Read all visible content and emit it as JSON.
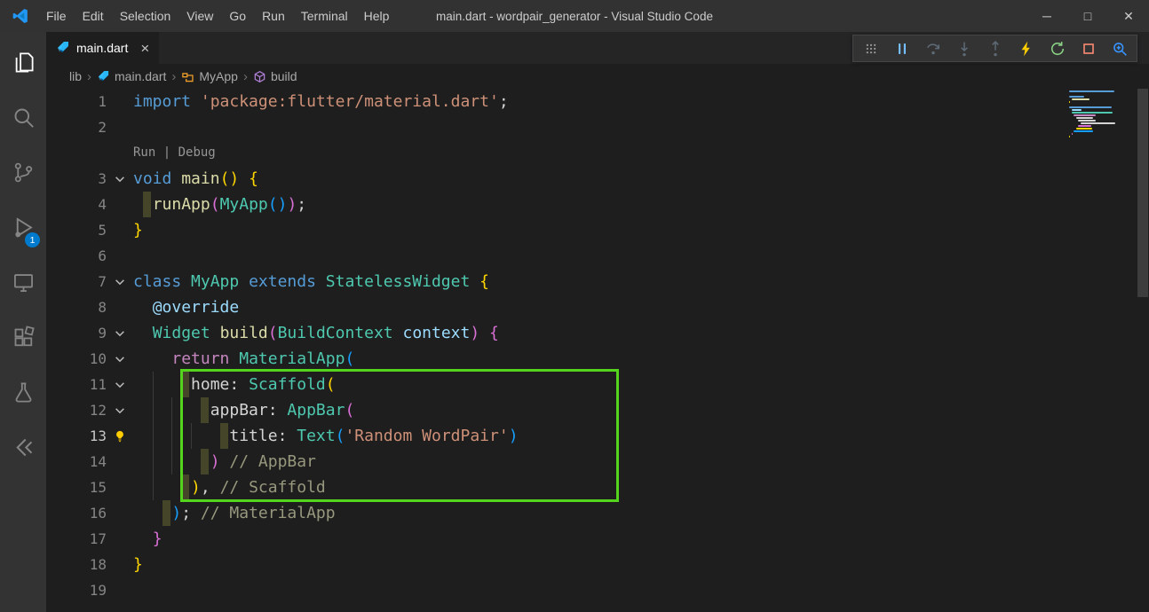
{
  "window": {
    "title": "main.dart - wordpair_generator - Visual Studio Code",
    "menus": [
      "File",
      "Edit",
      "Selection",
      "View",
      "Go",
      "Run",
      "Terminal",
      "Help"
    ],
    "controls": [
      {
        "name": "minimize",
        "glyph": "─"
      },
      {
        "name": "maximize",
        "glyph": "□"
      },
      {
        "name": "close",
        "glyph": "✕"
      }
    ]
  },
  "activity_bar": {
    "items": [
      {
        "name": "explorer",
        "icon": "explorer-icon",
        "active": true
      },
      {
        "name": "search",
        "icon": "search-icon"
      },
      {
        "name": "source-control",
        "icon": "source-control-icon"
      },
      {
        "name": "run-and-debug",
        "icon": "run-debug-icon",
        "badge": "1"
      },
      {
        "name": "remote-explorer",
        "icon": "remote-explorer-icon"
      },
      {
        "name": "extensions",
        "icon": "extensions-icon"
      },
      {
        "name": "testing",
        "icon": "testing-icon"
      },
      {
        "name": "flutter",
        "icon": "flutter-icon"
      }
    ]
  },
  "tabs": [
    {
      "label": "main.dart",
      "icon": "dart-file-icon",
      "close": "×",
      "active": true
    }
  ],
  "debug_toolbar": {
    "buttons": [
      {
        "name": "drag-handle",
        "icon": "drag-handle-icon",
        "color": "#9d9d9d"
      },
      {
        "name": "pause",
        "icon": "pause-icon",
        "color": "#75beff"
      },
      {
        "name": "step-over",
        "icon": "step-over-icon",
        "color": "#63707e",
        "disabled": true
      },
      {
        "name": "step-into",
        "icon": "step-into-icon",
        "color": "#63707e",
        "disabled": true
      },
      {
        "name": "step-out",
        "icon": "step-out-icon",
        "color": "#63707e",
        "disabled": true
      },
      {
        "name": "hot-reload",
        "icon": "hot-reload-icon",
        "color": "#ffcc00"
      },
      {
        "name": "restart",
        "icon": "restart-icon",
        "color": "#89d185"
      },
      {
        "name": "stop",
        "icon": "stop-icon",
        "color": "#f48771"
      },
      {
        "name": "widget-inspector",
        "icon": "widget-inspector-icon",
        "color": "#3794ff"
      }
    ]
  },
  "breadcrumbs": {
    "separator": "›",
    "items": [
      {
        "label": "lib"
      },
      {
        "label": "main.dart",
        "icon": "dart-file-icon"
      },
      {
        "label": "MyApp",
        "icon": "class-symbol-icon"
      },
      {
        "label": "build",
        "icon": "method-symbol-icon"
      }
    ]
  },
  "editor": {
    "codelens": {
      "run": "Run",
      "sep": " | ",
      "debug": "Debug"
    },
    "lines": [
      {
        "num": 1,
        "tokens": [
          [
            "import",
            "kw"
          ],
          [
            " ",
            "pl"
          ],
          [
            "'package:flutter/material.dart'",
            "str"
          ],
          [
            ";",
            "pl"
          ]
        ]
      },
      {
        "num": 2,
        "tokens": []
      },
      {
        "codelens": true
      },
      {
        "num": 3,
        "fold": true,
        "tokens": [
          [
            "void",
            "kw"
          ],
          [
            " ",
            "pl"
          ],
          [
            "main",
            "fn"
          ],
          [
            "(",
            "b1"
          ],
          [
            ")",
            "b1"
          ],
          [
            " ",
            "pl"
          ],
          [
            "{",
            "b1"
          ]
        ]
      },
      {
        "num": 4,
        "marker": 1,
        "tokens": [
          [
            "  ",
            "pl"
          ],
          [
            "runApp",
            "fn"
          ],
          [
            "(",
            "b2"
          ],
          [
            "MyApp",
            "type"
          ],
          [
            "(",
            "b3"
          ],
          [
            ")",
            "b3"
          ],
          [
            ")",
            "b2"
          ],
          [
            ";",
            "pl"
          ]
        ]
      },
      {
        "num": 5,
        "tokens": [
          [
            "}",
            "b1"
          ]
        ]
      },
      {
        "num": 6,
        "tokens": []
      },
      {
        "num": 7,
        "fold": true,
        "tokens": [
          [
            "class",
            "kw"
          ],
          [
            " ",
            "pl"
          ],
          [
            "MyApp",
            "type"
          ],
          [
            " ",
            "pl"
          ],
          [
            "extends",
            "kw"
          ],
          [
            " ",
            "pl"
          ],
          [
            "StatelessWidget",
            "type"
          ],
          [
            " ",
            "pl"
          ],
          [
            "{",
            "b1"
          ]
        ]
      },
      {
        "num": 8,
        "tokens": [
          [
            "  ",
            "pl"
          ],
          [
            "@override",
            "ann"
          ]
        ]
      },
      {
        "num": 9,
        "fold": true,
        "tokens": [
          [
            "  ",
            "pl"
          ],
          [
            "Widget",
            "type"
          ],
          [
            " ",
            "pl"
          ],
          [
            "build",
            "fn"
          ],
          [
            "(",
            "b2"
          ],
          [
            "BuildContext",
            "type"
          ],
          [
            " ",
            "pl"
          ],
          [
            "context",
            "param"
          ],
          [
            ")",
            "b2"
          ],
          [
            " ",
            "pl"
          ],
          [
            "{",
            "b2"
          ]
        ]
      },
      {
        "num": 10,
        "fold": true,
        "tokens": [
          [
            "    ",
            "pl"
          ],
          [
            "return",
            "ctrl"
          ],
          [
            " ",
            "pl"
          ],
          [
            "MaterialApp",
            "type"
          ],
          [
            "(",
            "b3"
          ]
        ]
      },
      {
        "num": 11,
        "fold": true,
        "marker": 5,
        "tokens": [
          [
            "      ",
            "pl"
          ],
          [
            "home",
            "prop"
          ],
          [
            ":",
            "pl"
          ],
          [
            " ",
            "pl"
          ],
          [
            "Scaffold",
            "type"
          ],
          [
            "(",
            "b1"
          ]
        ]
      },
      {
        "num": 12,
        "fold": true,
        "marker": 7,
        "tokens": [
          [
            "        ",
            "pl"
          ],
          [
            "appBar",
            "prop"
          ],
          [
            ":",
            "pl"
          ],
          [
            " ",
            "pl"
          ],
          [
            "AppBar",
            "type"
          ],
          [
            "(",
            "b2"
          ]
        ]
      },
      {
        "num": 13,
        "active": true,
        "bulb": true,
        "marker": 9,
        "tokens": [
          [
            "          ",
            "pl"
          ],
          [
            "title",
            "prop"
          ],
          [
            ":",
            "pl"
          ],
          [
            " ",
            "pl"
          ],
          [
            "Text",
            "type"
          ],
          [
            "(",
            "b3"
          ],
          [
            "'Random WordPair'",
            "str"
          ],
          [
            ")",
            "b3"
          ]
        ]
      },
      {
        "num": 14,
        "marker": 7,
        "tokens": [
          [
            "        ",
            "pl"
          ],
          [
            ")",
            "b2"
          ],
          [
            " ",
            "pl"
          ],
          [
            "// AppBar",
            "lbl"
          ]
        ]
      },
      {
        "num": 15,
        "marker": 5,
        "tokens": [
          [
            "      ",
            "pl"
          ],
          [
            ")",
            "b1"
          ],
          [
            ",",
            "pl"
          ],
          [
            " ",
            "pl"
          ],
          [
            "// Scaffold",
            "lbl"
          ]
        ]
      },
      {
        "num": 16,
        "marker": 3,
        "tokens": [
          [
            "    ",
            "pl"
          ],
          [
            ")",
            "b3"
          ],
          [
            ";",
            "pl"
          ],
          [
            " ",
            "pl"
          ],
          [
            "// MaterialApp",
            "lbl"
          ]
        ]
      },
      {
        "num": 17,
        "tokens": [
          [
            "  ",
            "pl"
          ],
          [
            "}",
            "b2"
          ]
        ]
      },
      {
        "num": 18,
        "tokens": [
          [
            "}",
            "b1"
          ]
        ]
      },
      {
        "num": 19,
        "tokens": []
      }
    ]
  },
  "colors": {
    "accent": "#007acc",
    "highlight_box_green": "#54d41d",
    "lightbulb_yellow": "#ffcc00",
    "tokens": {
      "kw": "#569cd6",
      "ctrl": "#c586c0",
      "type": "#4ec9b0",
      "fn": "#dcdcaa",
      "str": "#ce9178",
      "ann": "#9cdcfe",
      "param": "#9cdcfe",
      "prop": "#d4d4d4",
      "pl": "#d4d4d4",
      "lbl": "#98987e",
      "b1": "#ffd700",
      "b2": "#da70d6",
      "b3": "#179fff"
    }
  }
}
